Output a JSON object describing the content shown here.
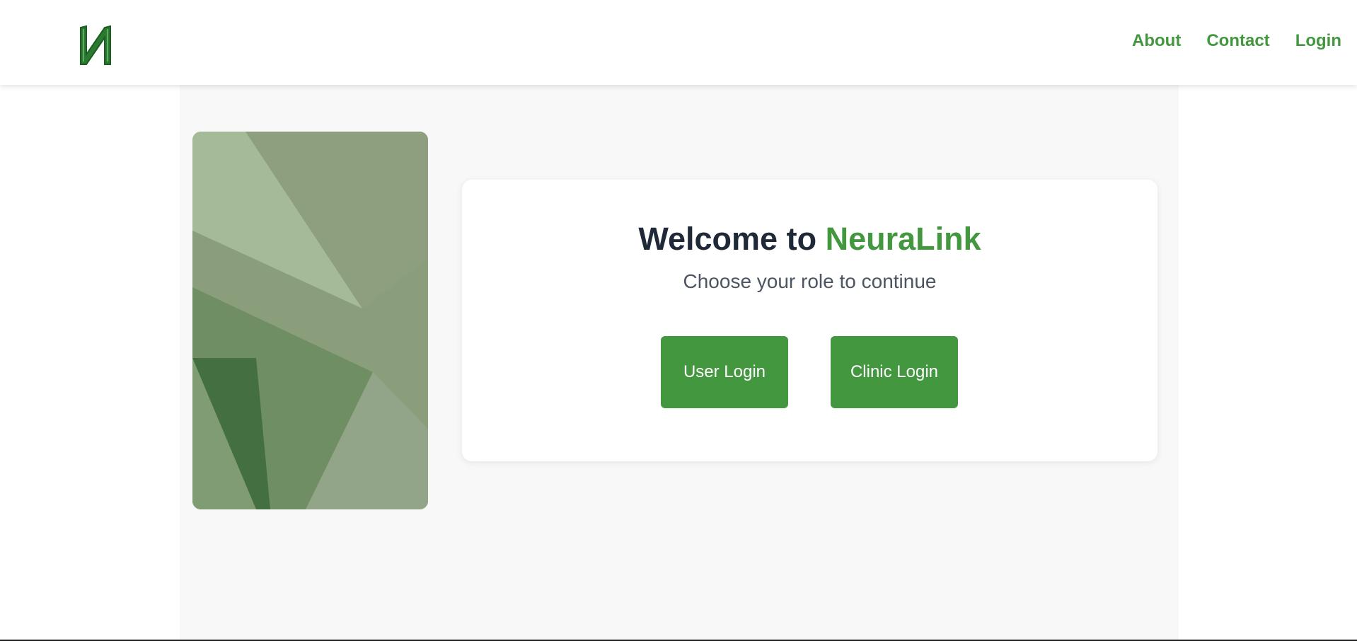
{
  "header": {
    "logo_letter": "N",
    "nav": {
      "about": "About",
      "contact": "Contact",
      "login": "Login"
    }
  },
  "main": {
    "welcome_prefix": "Welcome to",
    "brand_name": "NeuraLink",
    "subtitle": "Choose your role to continue",
    "buttons": {
      "user_login": "User Login",
      "clinic_login": "Clinic Login"
    }
  },
  "colors": {
    "accent": "#43983f",
    "heading": "#1f2937",
    "subtext": "#4b5563",
    "background_panel": "#f8f8f8"
  },
  "icons": {
    "logo": "neuralink-n-logo-icon"
  }
}
